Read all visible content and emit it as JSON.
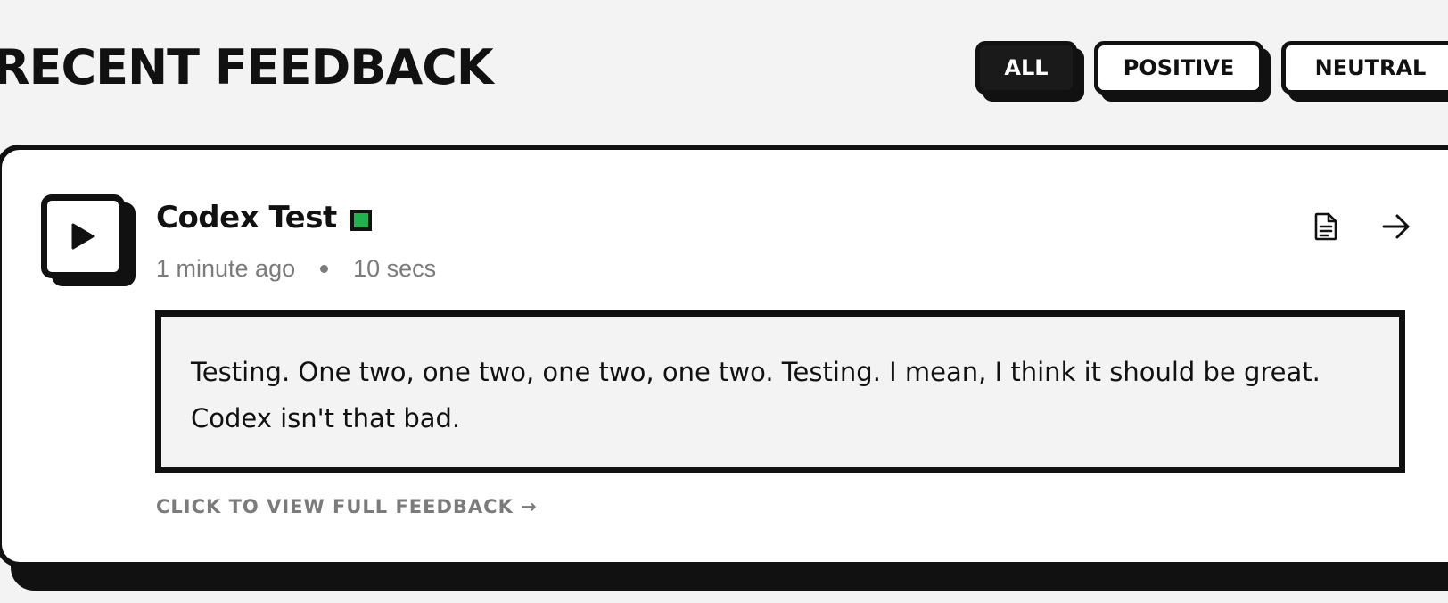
{
  "header": {
    "title": "RECENT FEEDBACK"
  },
  "filters": [
    {
      "label": "ALL",
      "active": true
    },
    {
      "label": "POSITIVE",
      "active": false
    },
    {
      "label": "NEUTRAL",
      "active": false
    }
  ],
  "feedback": {
    "title": "Codex Test",
    "sentiment_color": "#1fb24d",
    "time_ago": "1 minute ago",
    "duration": "10 secs",
    "quote": "Testing. One two, one two, one two, one two. Testing. I mean, I think it should be great. Codex isn't that bad.",
    "view_link": "CLICK TO VIEW FULL FEEDBACK →",
    "icons": {
      "play": "play-icon",
      "transcript": "document-icon",
      "open": "arrow-right-icon"
    }
  }
}
